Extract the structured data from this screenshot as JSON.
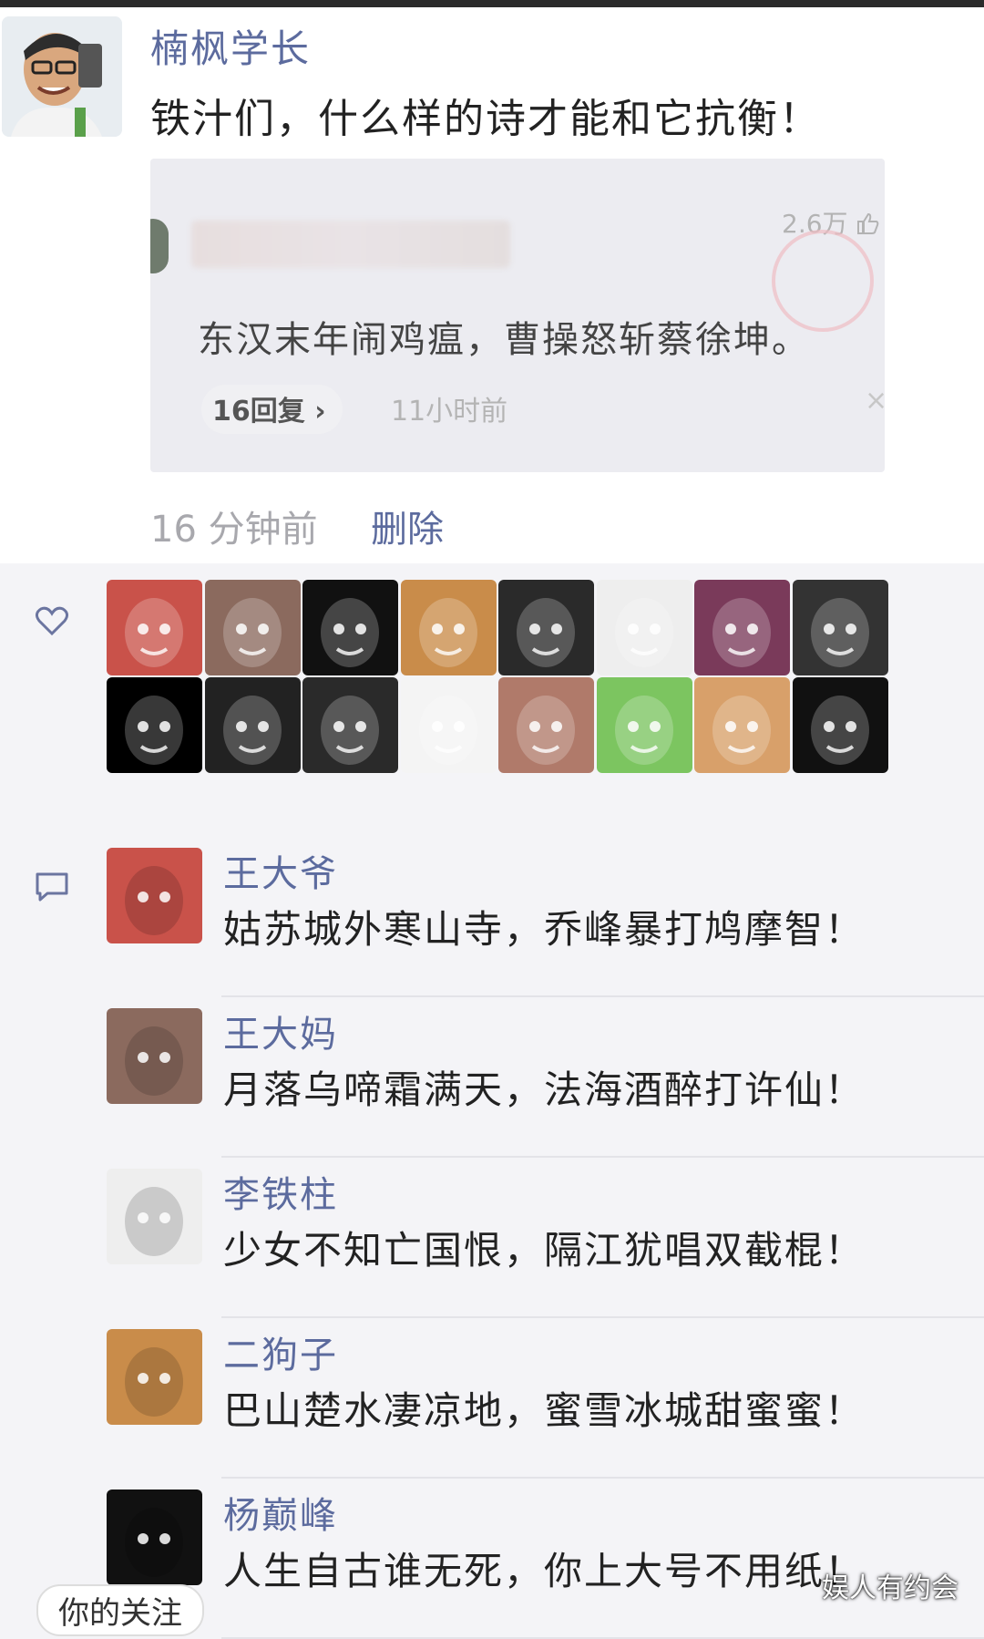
{
  "post": {
    "author": "楠枫学长",
    "text": "铁汁们，什么样的诗才能和它抗衡！",
    "quote": {
      "likes": "2.6万",
      "text": "东汉末年闹鸡瘟，曹操怒斩蔡徐坤。",
      "replies": "16回复 ›",
      "time": "11小时前",
      "close": "×"
    },
    "time": "16 分钟前",
    "delete_label": "删除"
  },
  "likes": {
    "icon": "heart-icon",
    "avatars": [
      {
        "name": "avatar-old-man",
        "color": "#c9524a"
      },
      {
        "name": "avatar-woman",
        "color": "#8b6a5e"
      },
      {
        "name": "avatar-black-mask-pigtails",
        "color": "#111111"
      },
      {
        "name": "avatar-shiba",
        "color": "#c98c4a"
      },
      {
        "name": "avatar-meme-bowl-cut",
        "color": "#2a2a2a"
      },
      {
        "name": "avatar-rage-face",
        "color": "#eeeeee"
      },
      {
        "name": "avatar-game-hero",
        "color": "#7a3a5a"
      },
      {
        "name": "avatar-meme-bun",
        "color": "#333333"
      },
      {
        "name": "avatar-black-smile",
        "color": "#000000"
      },
      {
        "name": "avatar-pink-glasses",
        "color": "#222222"
      },
      {
        "name": "avatar-meme-arms-crossed",
        "color": "#2a2a2a"
      },
      {
        "name": "avatar-panda-meme",
        "color": "#f4f4f4"
      },
      {
        "name": "avatar-alien-glasses",
        "color": "#b07a6a"
      },
      {
        "name": "avatar-frog",
        "color": "#7cc560"
      },
      {
        "name": "avatar-dog-face",
        "color": "#d8a06a"
      },
      {
        "name": "avatar-black-mask",
        "color": "#111111"
      }
    ]
  },
  "comments": {
    "icon": "comment-icon",
    "items": [
      {
        "name": "王大爷",
        "text": "姑苏城外寒山寺，乔峰暴打鸠摩智！",
        "avatar": "#c9524a"
      },
      {
        "name": "王大妈",
        "text": "月落乌啼霜满天，法海酒醉打许仙！",
        "avatar": "#8b6a5e"
      },
      {
        "name": "李铁柱",
        "text": "少女不知亡国恨，隔江犹唱双截棍！",
        "avatar": "#eeeeee"
      },
      {
        "name": "二狗子",
        "text": "巴山楚水凄凉地，蜜雪冰城甜蜜蜜！",
        "avatar": "#c98c4a"
      },
      {
        "name": "杨巅峰",
        "text": "人生自古谁无死，你上大号不用纸！",
        "avatar": "#111111"
      }
    ]
  },
  "bottom_tag": "你的关注",
  "watermark": "娱人有约会"
}
